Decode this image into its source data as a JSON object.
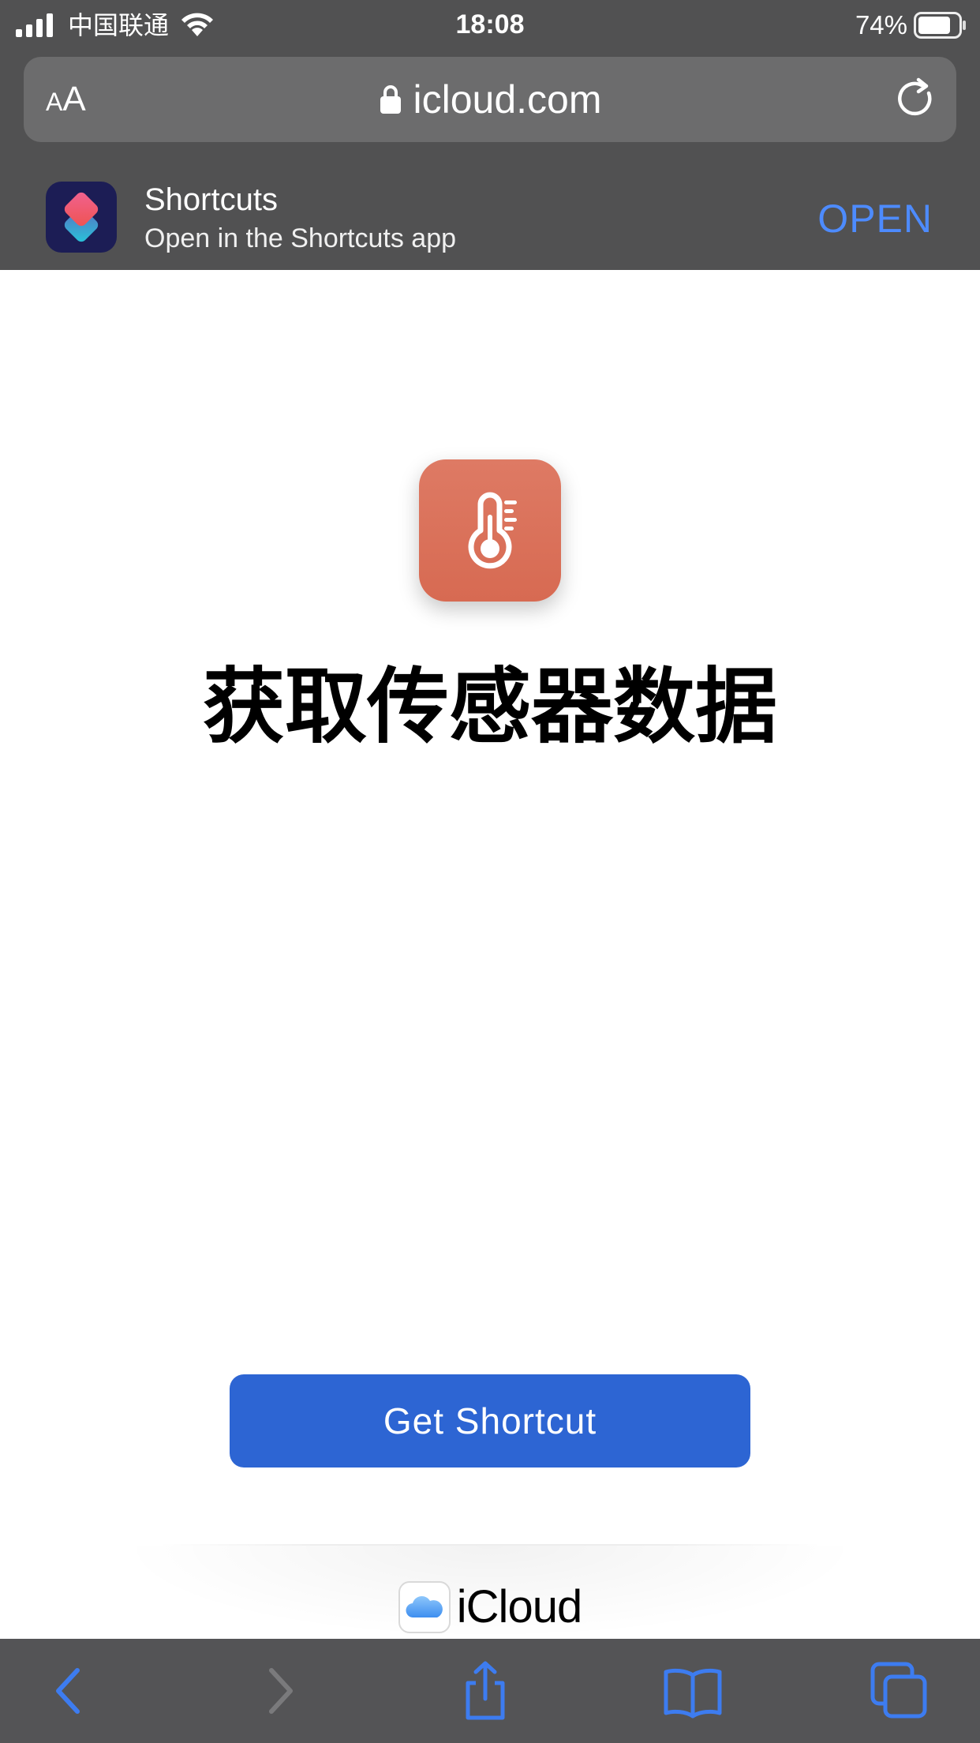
{
  "status_bar": {
    "carrier": "中国联通",
    "time": "18:08",
    "battery_percent": "74%"
  },
  "address_bar": {
    "text_size_small": "A",
    "text_size_large": "A",
    "url": "icloud.com"
  },
  "app_banner": {
    "app_name": "Shortcuts",
    "subtitle": "Open in the Shortcuts app",
    "open_label": "OPEN"
  },
  "shortcut": {
    "title": "获取传感器数据",
    "icon": "thermometer-icon",
    "icon_color": "#d9705a"
  },
  "get_button_label": "Get Shortcut",
  "footer": {
    "brand": "iCloud"
  },
  "colors": {
    "chrome_background": "#515152",
    "link_blue": "#4d8bff",
    "button_blue": "#2d65d3",
    "toolbar_icon_blue": "#3d7cf0"
  },
  "toolbar": {
    "buttons": [
      "back-icon",
      "forward-icon",
      "share-icon",
      "bookmarks-icon",
      "tabs-icon"
    ]
  }
}
